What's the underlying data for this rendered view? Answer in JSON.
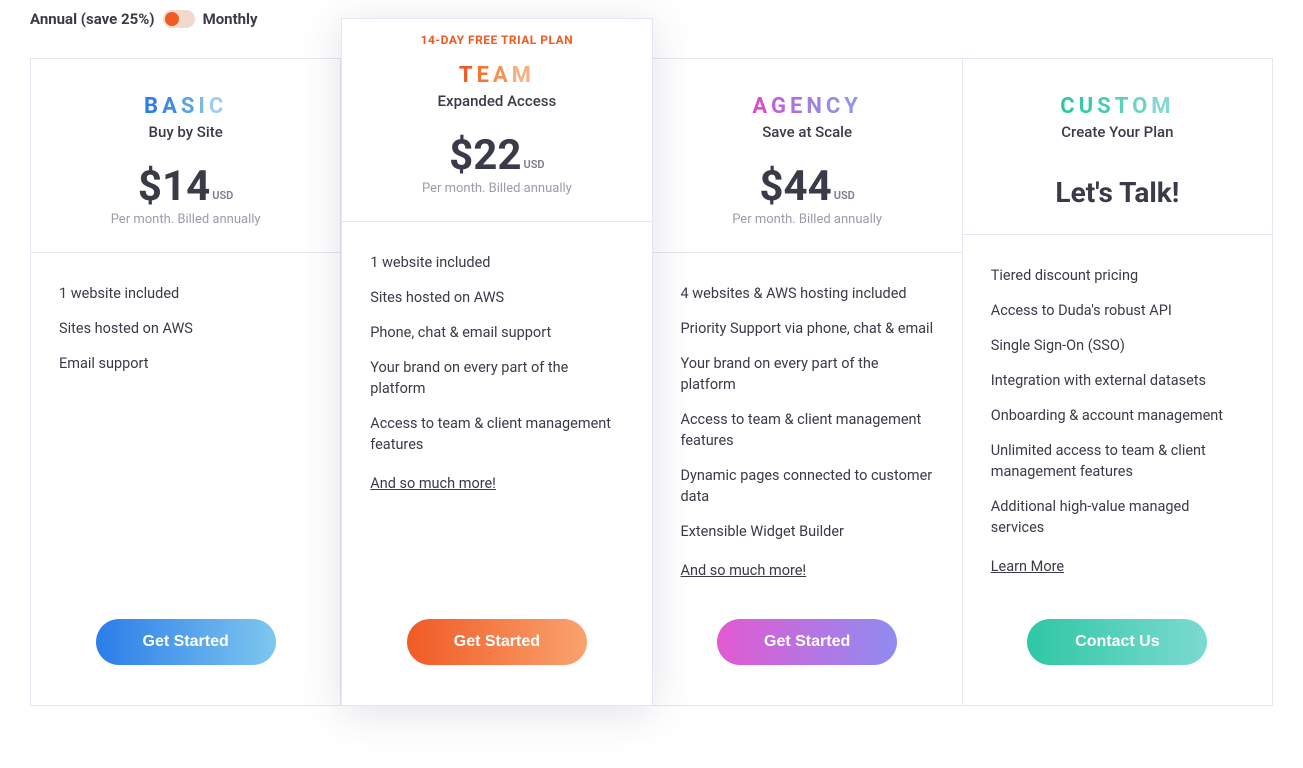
{
  "toggle": {
    "annual_label": "Annual",
    "save_label": " (save 25%)",
    "monthly_label": "Monthly"
  },
  "trial_banner": "14-DAY FREE TRIAL PLAN",
  "currency_sub": "USD",
  "price_note": "Per month. Billed annually",
  "plans": {
    "basic": {
      "title_chars": [
        "B",
        "A",
        "S",
        "I",
        "C"
      ],
      "sub": "Buy by Site",
      "price": "$14",
      "features": [
        "1 website included",
        "Sites hosted on AWS",
        "Email support"
      ],
      "cta": "Get Started"
    },
    "team": {
      "title_chars": [
        "T",
        "E",
        "A",
        "M"
      ],
      "sub": "Expanded Access",
      "price": "$22",
      "features": [
        "1 website included",
        "Sites hosted on AWS",
        "Phone, chat & email support",
        "Your brand on every part of the platform",
        "Access to team & client management features"
      ],
      "more": "And so much more!",
      "cta": "Get Started"
    },
    "agency": {
      "title_chars": [
        "A",
        "G",
        "E",
        "N",
        "C",
        "Y"
      ],
      "sub": "Save at Scale",
      "price": "$44",
      "features": [
        "4 websites & AWS hosting included",
        "Priority Support via phone, chat & email",
        "Your brand on every part of the platform",
        "Access to team & client management features",
        "Dynamic pages connected to customer data",
        "Extensible Widget Builder"
      ],
      "more": "And so much more!",
      "cta": "Get Started"
    },
    "custom": {
      "title_chars": [
        "C",
        "U",
        "S",
        "T",
        "O",
        "M"
      ],
      "sub": "Create Your Plan",
      "lets_talk": "Let's Talk!",
      "features": [
        "Tiered discount pricing",
        "Access to Duda's robust API",
        "Single Sign-On (SSO)",
        "Integration with external datasets",
        "Onboarding & account management",
        "Unlimited access to team & client management features",
        "Additional high-value managed services"
      ],
      "more": "Learn More",
      "cta": "Contact Us"
    }
  }
}
